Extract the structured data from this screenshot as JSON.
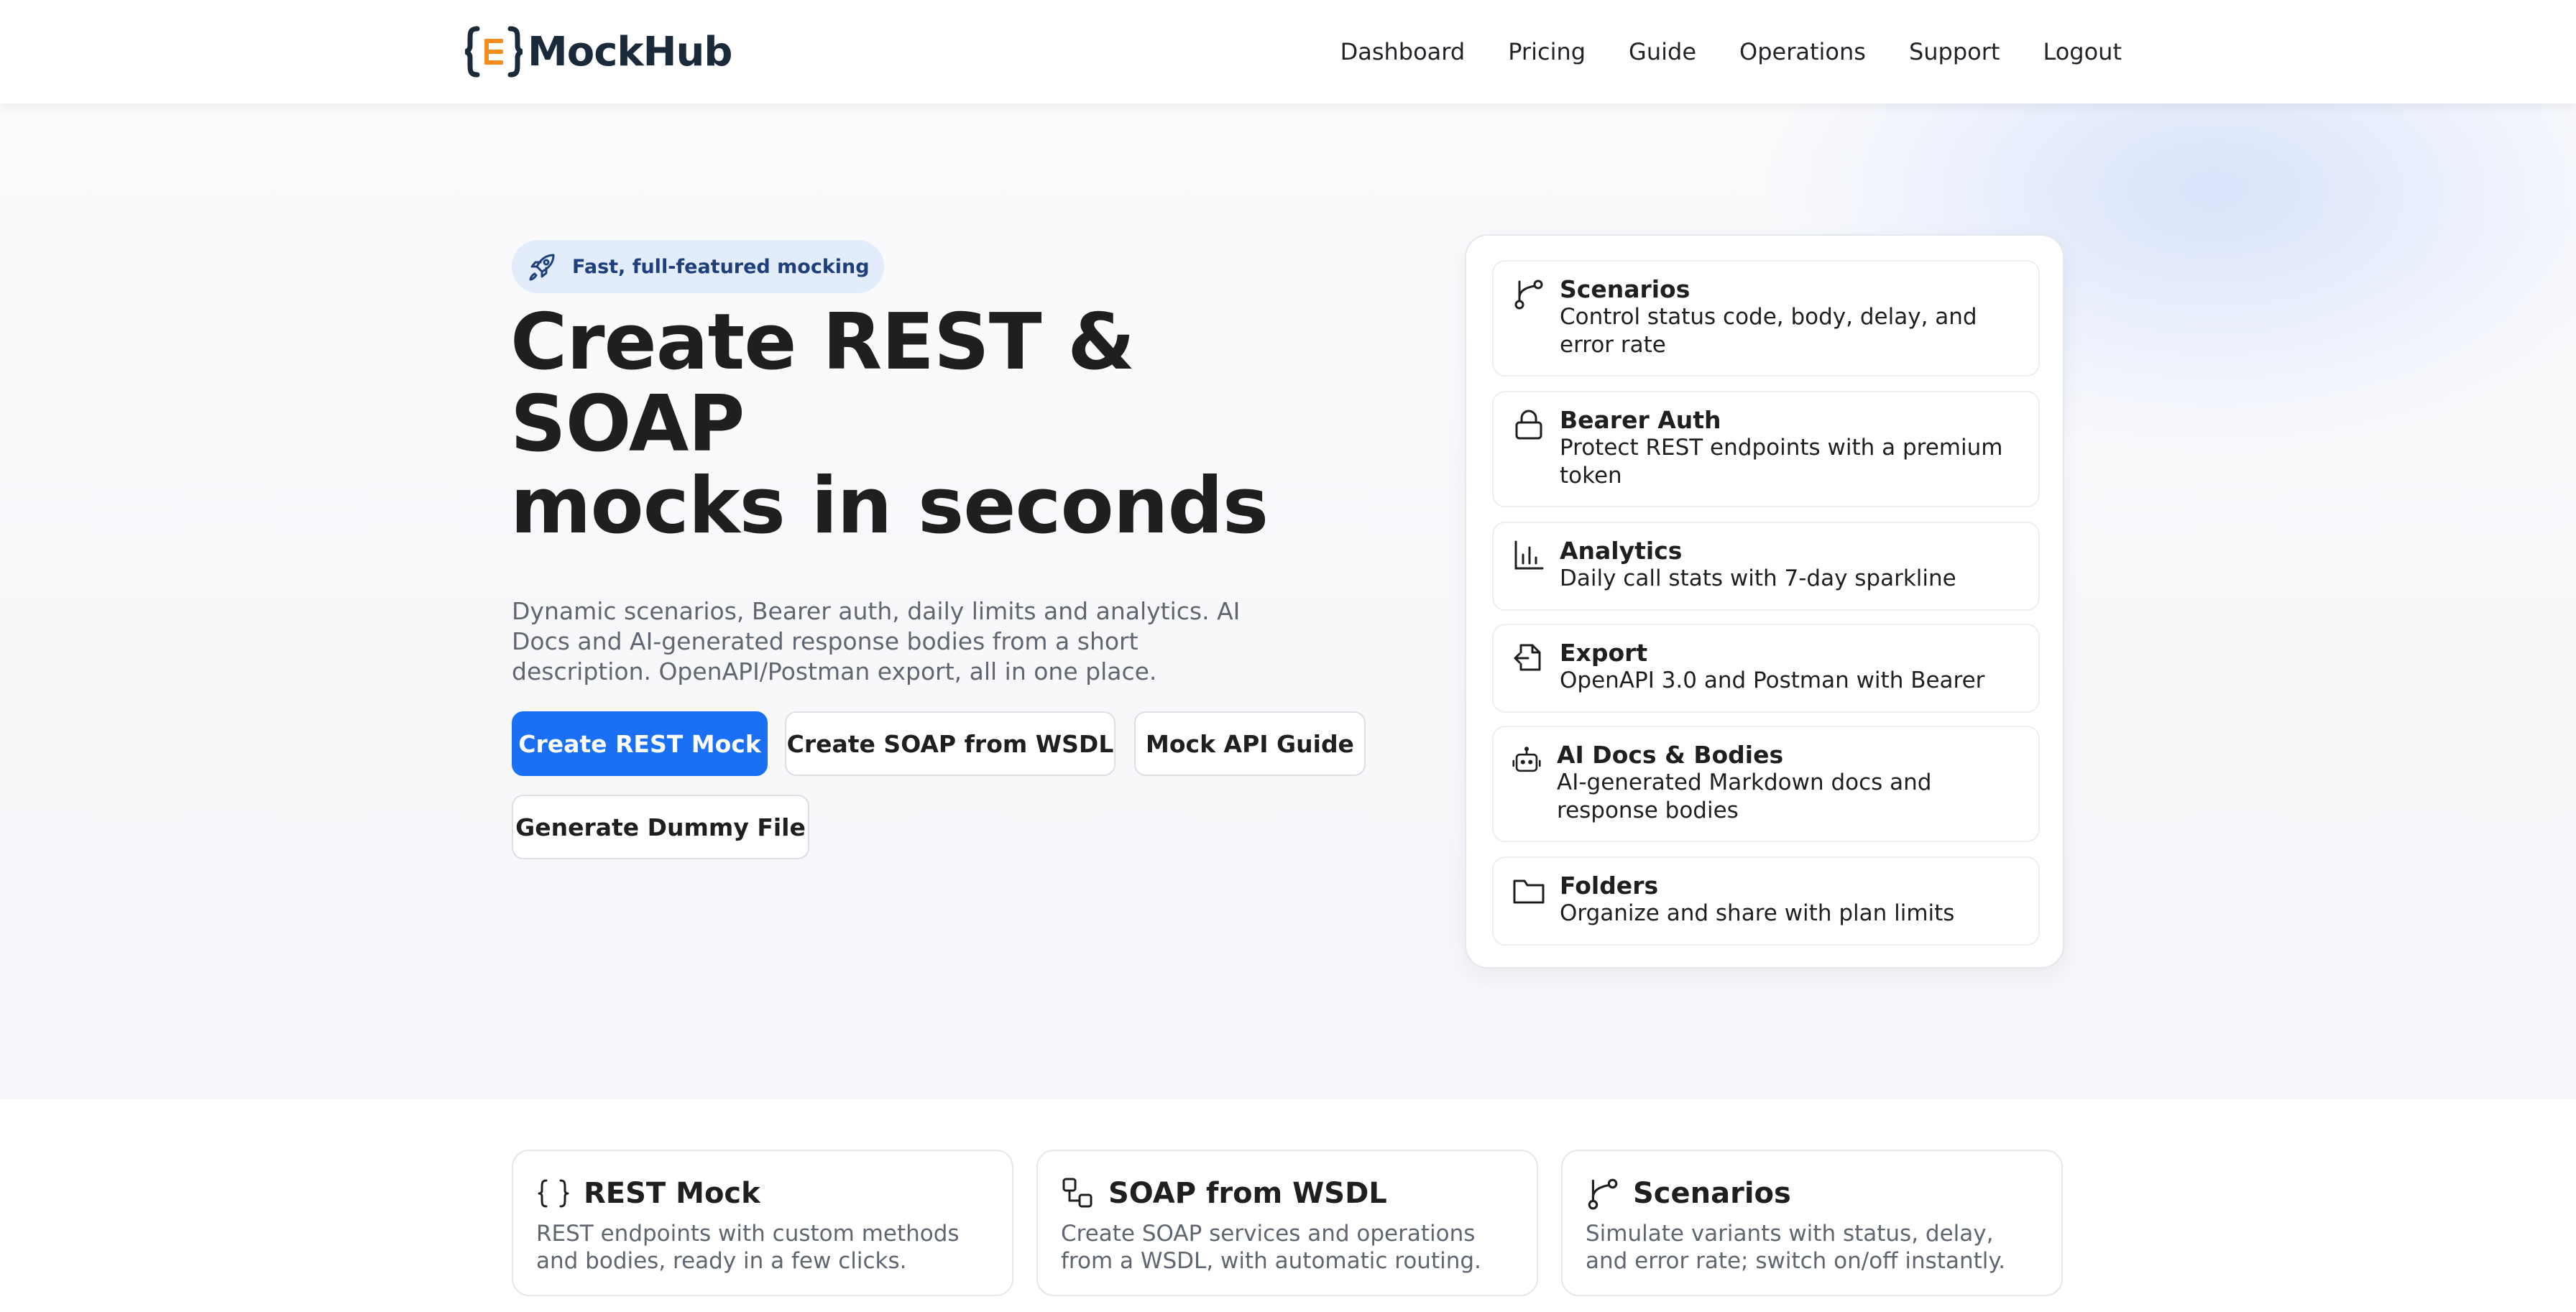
{
  "brand": {
    "name": "MockHub",
    "accent": "#f28c1e",
    "dark": "#1b2a3a"
  },
  "nav": {
    "items": [
      "Dashboard",
      "Pricing",
      "Guide",
      "Operations",
      "Support",
      "Logout"
    ]
  },
  "hero": {
    "badge": "Fast, full-featured mocking",
    "title_line1": "Create REST & SOAP",
    "title_line2": "mocks in seconds",
    "description": "Dynamic scenarios, Bearer auth, daily limits and analytics. AI Docs and AI-generated response bodies from a short description. OpenAPI/Postman export, all in one place.",
    "buttons": {
      "rest": "Create REST Mock",
      "soap": "Create SOAP from WSDL",
      "guide": "Mock API Guide",
      "dummy": "Generate Dummy File"
    },
    "primary_color": "#1a6ff4"
  },
  "features": [
    {
      "icon": "branch-icon",
      "title": "Scenarios",
      "desc": "Control status code, body, delay, and error rate"
    },
    {
      "icon": "lock-icon",
      "title": "Bearer Auth",
      "desc": "Protect REST endpoints with a premium token"
    },
    {
      "icon": "bar-chart-icon",
      "title": "Analytics",
      "desc": "Daily call stats with 7-day sparkline"
    },
    {
      "icon": "file-export-icon",
      "title": "Export",
      "desc": "OpenAPI 3.0 and Postman with Bearer"
    },
    {
      "icon": "robot-icon",
      "title": "AI Docs & Bodies",
      "desc": "AI-generated Markdown docs and response bodies"
    },
    {
      "icon": "folder-icon",
      "title": "Folders",
      "desc": "Organize and share with plan limits"
    }
  ],
  "cards": [
    {
      "icon": "braces-icon",
      "title": "REST Mock",
      "desc": "REST endpoints with custom methods and bodies, ready in a few clicks."
    },
    {
      "icon": "nodes-icon",
      "title": "SOAP from WSDL",
      "desc": "Create SOAP services and operations from a WSDL, with automatic routing."
    },
    {
      "icon": "branch-icon",
      "title": "Scenarios",
      "desc": "Simulate variants with status, delay, and error rate; switch on/off instantly."
    }
  ]
}
